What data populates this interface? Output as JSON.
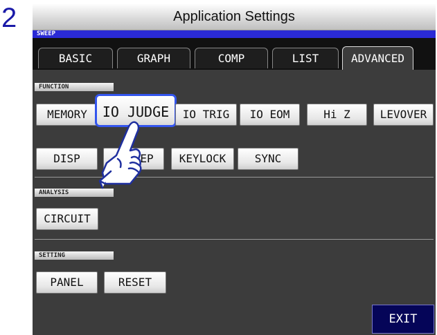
{
  "step_number": "2",
  "window": {
    "title": "Application Settings"
  },
  "mode_label": "SWEEP",
  "tabs": [
    {
      "label": "BASIC"
    },
    {
      "label": "GRAPH"
    },
    {
      "label": "COMP"
    },
    {
      "label": "LIST"
    },
    {
      "label": "ADVANCED",
      "active": true
    }
  ],
  "function_section": {
    "header": "FUNCTION",
    "buttons": [
      "MEMORY",
      "IO JUDGE",
      "IO TRIG",
      "IO EOM",
      "Hi Z",
      "LEVOVER",
      "DISP",
      "BEEP",
      "KEYLOCK",
      "SYNC"
    ],
    "obscured_label_visible": "EP",
    "selected": "IO JUDGE"
  },
  "analysis_section": {
    "header": "ANALYSIS",
    "buttons": [
      "CIRCUIT"
    ]
  },
  "setting_section": {
    "header": "SETTING",
    "buttons": [
      "PANEL",
      "RESET"
    ]
  },
  "exit_label": "EXIT",
  "colors": {
    "mode_bar": "#2a2ad6",
    "selection_border": "#3355ee",
    "exit_bg": "#050558",
    "screen_bg": "#3c3c3c",
    "step_number": "#1a1aa8"
  },
  "icons": {
    "pointer": "hand-pointer-icon"
  }
}
